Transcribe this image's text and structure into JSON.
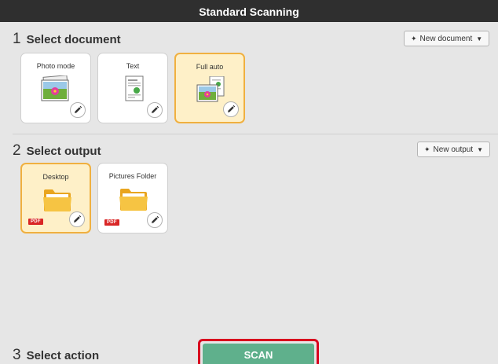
{
  "window": {
    "title": "Standard Scanning"
  },
  "document_section": {
    "number": "1",
    "title": "Select document",
    "new_button_label": "New document",
    "cards": [
      {
        "label": "Photo mode",
        "icon": "photo-icon",
        "selected": false
      },
      {
        "label": "Text",
        "icon": "text-document-icon",
        "selected": false
      },
      {
        "label": "Full auto",
        "icon": "full-auto-icon",
        "selected": true
      }
    ]
  },
  "output_section": {
    "number": "2",
    "title": "Select output",
    "new_button_label": "New output",
    "cards": [
      {
        "label": "Desktop",
        "icon": "folder-icon",
        "badge": "PDF",
        "selected": true
      },
      {
        "label": "Pictures Folder",
        "icon": "folder-icon",
        "badge": "PDF",
        "selected": false
      }
    ]
  },
  "action_section": {
    "number": "3",
    "title": "Select action",
    "scan_label": "SCAN"
  },
  "colors": {
    "titlebar": "#2f2f2f",
    "background": "#e6e6e6",
    "selected_card_fill": "#fef0c8",
    "selected_card_border": "#f0b040",
    "scan_button": "#5fb08c",
    "highlight_frame": "#d8001e",
    "pdf_badge": "#d92626"
  }
}
